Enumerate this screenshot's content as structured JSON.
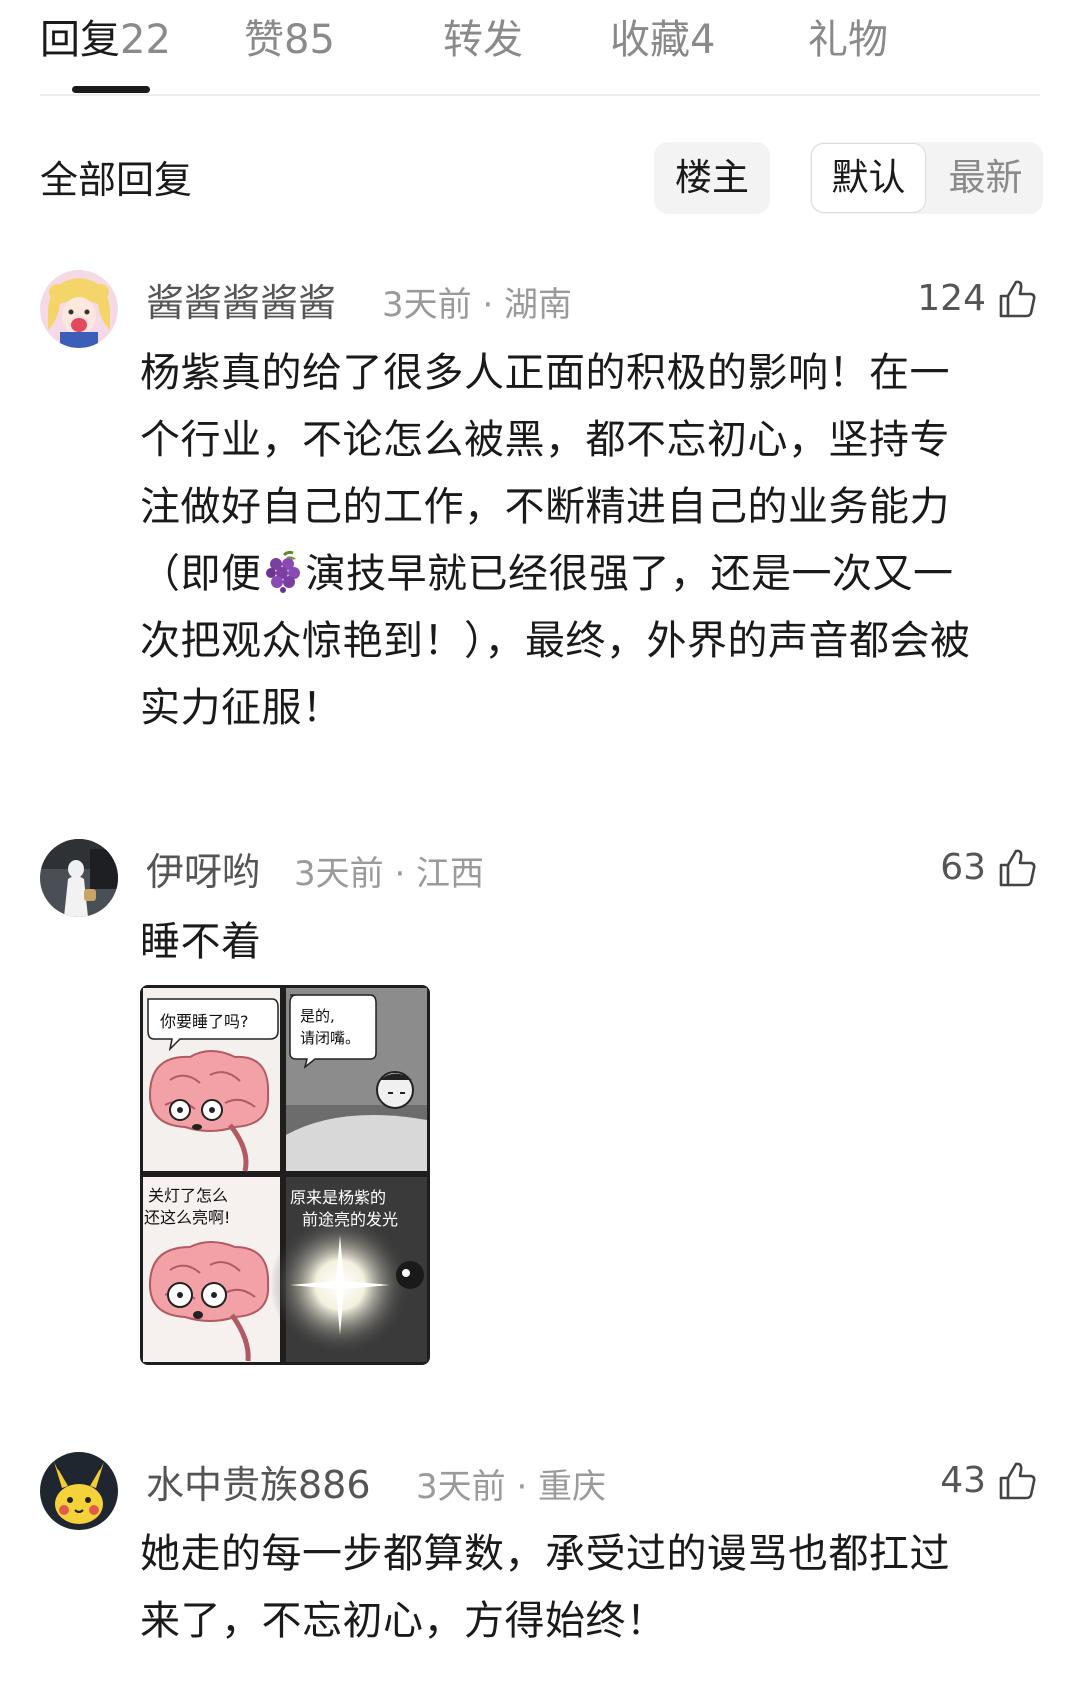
{
  "tabs": [
    {
      "label": "回复",
      "count": "22"
    },
    {
      "label": "赞",
      "count": "85"
    },
    {
      "label": "转发",
      "count": ""
    },
    {
      "label": "收藏",
      "count": "4"
    },
    {
      "label": "礼物",
      "count": ""
    }
  ],
  "filter": {
    "section_title": "全部回复",
    "op_button": "楼主",
    "sort_default": "默认",
    "sort_newest": "最新"
  },
  "comments": [
    {
      "username": "酱酱酱酱酱",
      "meta": "3天前 · 湖南",
      "likes": "124",
      "text_lines": [
        "杨紫真的给了很多人正面的积极的影响！在一",
        "个行业，不论怎么被黑，都不忘初心，坚持专",
        "注做好自己的工作，不断精进自己的业务能力",
        "（即便",
        "演技早就已经很强了，还是一次又一",
        "次把观众惊艳到！），最终，外界的声音都会被",
        "实力征服！"
      ],
      "emoji": "grape-icon"
    },
    {
      "username": "伊呀哟",
      "meta": "3天前 · 江西",
      "likes": "63",
      "text": "睡不着",
      "image": {
        "panel1": "你要睡了吗?",
        "panel2_line1": "是的,",
        "panel2_line2": "请闭嘴。",
        "panel3_line1": "关灯了怎么",
        "panel3_line2": "还这么亮啊!",
        "panel4_line1": "原来是杨紫的",
        "panel4_line2": "前途亮的发光"
      }
    },
    {
      "username": "水中贵族886",
      "meta": "3天前 · 重庆",
      "likes": "43",
      "text_lines": [
        "她走的每一步都算数，承受过的谩骂也都扛过",
        "来了，不忘初心，方得始终！"
      ]
    }
  ],
  "colors": {
    "primary_text": "#1a1a1a",
    "secondary_text": "#555555",
    "muted_text": "#9a9a9a",
    "chip_background": "#f3f3f3",
    "divider": "#ececec"
  }
}
